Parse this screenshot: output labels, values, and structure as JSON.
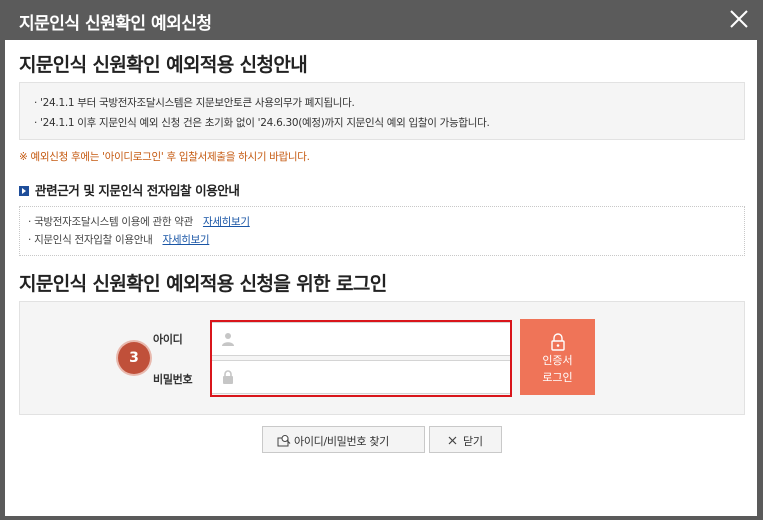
{
  "window": {
    "title": "지문인식 신원확인 예외신청"
  },
  "heading_main": "지문인식 신원확인 예외적용 신청안내",
  "notices": [
    "· '24.1.1 부터 국방전자조달시스템은 지문보안토큰 사용의무가 폐지됩니다.",
    "· '24.1.1 이후 지문인식 예외 신청 건은 초기화 없이 '24.6.30(예정)까지 지문인식 예외 입찰이 가능합니다."
  ],
  "warning": "※ 예외신청 후에는 '아이디로그인' 후 입찰서제출을 하시기 바랍니다.",
  "sub_heading": "관련근거 및 지문인식 전자입찰 이용안내",
  "links": [
    {
      "label": "· 국방전자조달시스템 이용에 관한 약관",
      "link": "자세히보기"
    },
    {
      "label": "· 지문인식 전자입찰 이용안내",
      "link": "자세히보기"
    }
  ],
  "heading_login": "지문인식 신원확인 예외적용 신청을 위한 로그인",
  "login": {
    "step": "3",
    "id_label": "아이디",
    "pw_label": "비밀번호",
    "id_value": "",
    "pw_value": "",
    "cert_line1": "인증서",
    "cert_line2": "로그인"
  },
  "buttons": {
    "find": "아이디/비밀번호 찾기",
    "close": "닫기"
  },
  "colors": {
    "titlebar": "#5b5b5b",
    "accent": "#ef7458",
    "highlight": "#d9151b",
    "warning": "#c55a11",
    "link": "#1a56a6"
  }
}
